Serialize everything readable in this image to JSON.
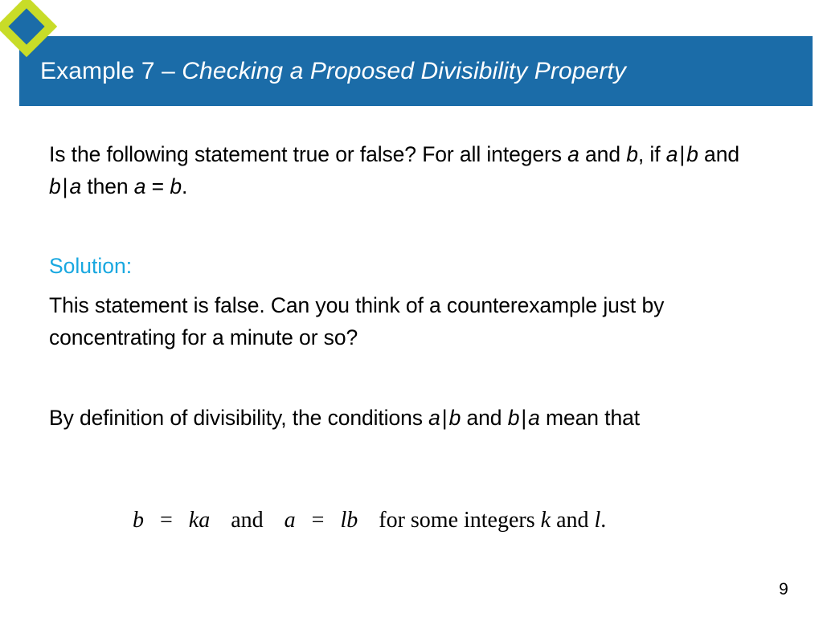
{
  "slide": {
    "title": {
      "prefix": "Example 7 – ",
      "emphasis": "Checking a Proposed Divisibility Property"
    },
    "page_number": "9",
    "colors": {
      "title_bar": "#1b6ca8",
      "diamond_outer": "#c8dc28",
      "diamond_inner": "#1b6ca8",
      "solution_label": "#19a8e0",
      "body_text": "#000000",
      "background": "#ffffff"
    },
    "question": {
      "part1": "Is the following statement true or false? For all integers ",
      "var_a1": "a",
      "part2": " and ",
      "var_b1": "b",
      "part3": ", if ",
      "var_a2": "a",
      "bar1": "|",
      "var_b2": "b",
      "part4": " and ",
      "var_b3": "b",
      "bar2": "|",
      "var_a3": "a",
      "part5": " then ",
      "var_a4": "a",
      "equals": " = ",
      "var_b4": "b",
      "period": "."
    },
    "solution_label": "Solution:",
    "solution_text": "This statement is false. Can you think of a counterexample just by concentrating for a minute or so?",
    "definition": {
      "part1": "By definition of divisibility, the conditions ",
      "var_a1": "a",
      "bar1": "|",
      "var_b1": "b",
      "part2": " and ",
      "var_b2": "b",
      "bar2": "|",
      "var_a2": "a",
      "part3": " mean that"
    },
    "equation": {
      "lhs_var": "b",
      "lhs_eq": "=",
      "lhs_rhs1": "k",
      "lhs_rhs2": "a",
      "conjunction": "and",
      "rhs_var": "a",
      "rhs_eq": "=",
      "rhs_rhs1": "l",
      "rhs_rhs2": "b",
      "suffix": "for some integers ",
      "int_k": "k",
      "suffix_and": " and ",
      "int_l": "l",
      "suffix_period": "."
    }
  }
}
